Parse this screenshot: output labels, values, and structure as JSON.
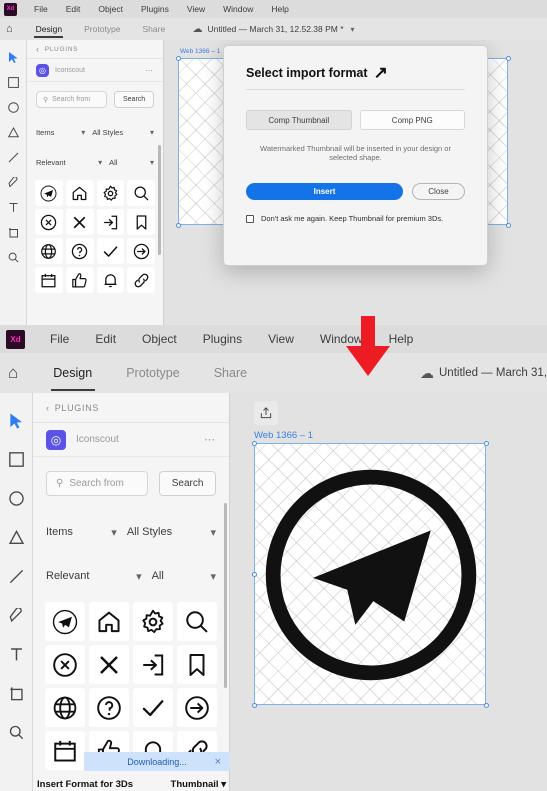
{
  "app": {
    "logo_text": "Xd",
    "menu": [
      "File",
      "Edit",
      "Object",
      "Plugins",
      "View",
      "Window",
      "Help"
    ],
    "mode_tabs": [
      "Design",
      "Prototype",
      "Share"
    ],
    "active_mode": "Design",
    "doc_title_full": "Untitled — March 31, 12.52.38 PM *",
    "doc_title_clipped": "Untitled — March 31, 12.5",
    "home_icon": "home-icon",
    "cloud_icon": "cloud-icon",
    "chevron_icon": "chevron-down-icon"
  },
  "toolbar": {
    "tools": [
      {
        "name": "select-tool",
        "icon": "cursor-arrow-icon"
      },
      {
        "name": "rectangle-tool",
        "icon": "square-icon"
      },
      {
        "name": "ellipse-tool",
        "icon": "circle-icon"
      },
      {
        "name": "polygon-tool",
        "icon": "triangle-icon"
      },
      {
        "name": "line-tool",
        "icon": "line-icon"
      },
      {
        "name": "pen-tool",
        "icon": "pen-icon"
      },
      {
        "name": "text-tool",
        "icon": "text-t-icon"
      },
      {
        "name": "artboard-tool",
        "icon": "artboard-icon"
      },
      {
        "name": "zoom-tool",
        "icon": "magnifier-icon"
      }
    ],
    "active_tool": "select-tool"
  },
  "plugin_panel": {
    "header": "PLUGINS",
    "back_icon": "chevron-left-icon",
    "plugin_name": "Iconscout",
    "plugin_logo_icon": "iconscout-logo-icon",
    "overflow_icon": "more-dots-icon",
    "search_placeholder": "Search from",
    "search_icon": "search-icon",
    "search_button": "Search",
    "filters": [
      {
        "label": "Items",
        "value": "All Styles"
      },
      {
        "label": "Relevant",
        "value": "All"
      }
    ],
    "icons_grid": [
      "telegram-circle-icon",
      "home-icon",
      "gear-icon",
      "search-icon",
      "x-circle-icon",
      "close-x-icon",
      "login-icon",
      "bookmark-icon",
      "globe-icon",
      "question-circle-icon",
      "check-icon",
      "arrow-right-circle-icon",
      "calendar-icon",
      "thumbs-up-icon",
      "bell-icon",
      "link-icon"
    ]
  },
  "canvas": {
    "artboard_label": "Web 1366 – 1",
    "export_icon": "export-share-icon",
    "artboard_content_icon": "telegram-circle-icon",
    "selection_handles": 4,
    "watermark": "crosshatch-diamond-pattern"
  },
  "dialog": {
    "title": "Select import format",
    "title_icon": "arrow-up-right-icon",
    "segments": [
      {
        "label": "Comp Thumbnail",
        "selected": true
      },
      {
        "label": "Comp PNG",
        "selected": false
      }
    ],
    "description": "Watermarked Thumbnail will be inserted in your design or selected shape.",
    "primary_button": "Insert",
    "secondary_button": "Close",
    "checkbox_label": "Don't ask me again. Keep Thumbnail for premium 3Ds.",
    "checkbox_checked": false
  },
  "toast": {
    "message": "Downloading...",
    "close_icon": "close-x-icon"
  },
  "footer": {
    "left_label": "Insert Format for 3Ds",
    "right_label": "Thumbnail",
    "right_chevron": "chevron-down-icon"
  },
  "annotation": {
    "arrow_icon": "red-down-arrow-icon",
    "color": "#ED1C24"
  },
  "colors": {
    "accent_blue": "#1473e6",
    "plugin_purple": "#5b53e8",
    "artboard_label_blue": "#3a7fe0",
    "toast_bg": "#cfe2fb",
    "red": "#ED1C24"
  }
}
